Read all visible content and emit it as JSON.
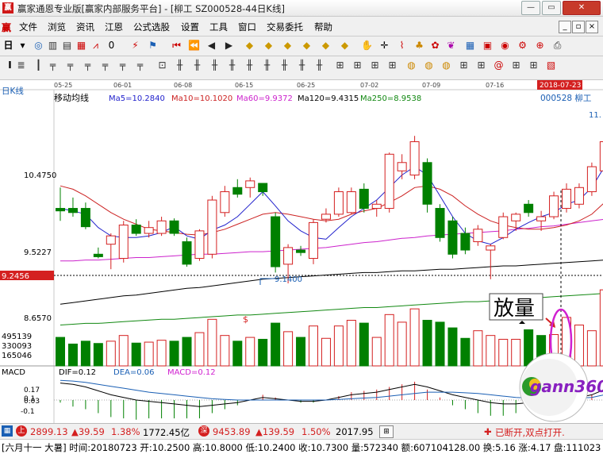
{
  "window": {
    "title": "赢家通恩专业版[赢家内部服务平台] - [柳工  SZ000528-44日K线]",
    "logo": "赢"
  },
  "menu": {
    "logo": "赢",
    "items": [
      "文件",
      "浏览",
      "资讯",
      "江恩",
      "公式选股",
      "设置",
      "工具",
      "窗口",
      "交易委托",
      "帮助"
    ]
  },
  "toolbar1": {
    "period": "日"
  },
  "chart": {
    "period_label": "日K线",
    "indicator_name": "移动均线",
    "ma": [
      {
        "label": "Ma5=10.2840",
        "color": "#2222cc"
      },
      {
        "label": "Ma10=10.1020",
        "color": "#cc2222"
      },
      {
        "label": "Ma60=9.9372",
        "color": "#cc22cc"
      },
      {
        "label": "Ma120=9.4315",
        "color": "#000000"
      },
      {
        "label": "Ma250=8.9538",
        "color": "#118811"
      }
    ],
    "stock_label": "000528  柳工",
    "right_price": "11.",
    "current_date": "2018-07-23",
    "date_ticks": [
      "05-25",
      "06-01",
      "06-08",
      "06-15",
      "06-25",
      "07-02",
      "07-09",
      "07-16"
    ],
    "price_ticks": [
      "10.4750",
      "9.5227",
      "8.6570"
    ],
    "volume_ticks": [
      "495139",
      "330093",
      "165046"
    ],
    "current_price_tag": "9.2456",
    "low_label": "9.1400",
    "dollar_mark": "$",
    "annotation": "放量"
  },
  "chart_data": {
    "type": "candlestick",
    "x_ticks": [
      "05-25",
      "06-01",
      "06-08",
      "06-15",
      "06-25",
      "07-02",
      "07-09",
      "07-16"
    ],
    "y_ticks": [
      10.475,
      9.5227,
      8.657
    ],
    "highlight_date": "2018-07-23",
    "candles": [
      {
        "o": 10.05,
        "h": 10.3,
        "l": 9.9,
        "c": 10.02
      },
      {
        "o": 10.05,
        "h": 10.18,
        "l": 9.95,
        "c": 10.0
      },
      {
        "o": 10.05,
        "h": 10.12,
        "l": 9.8,
        "c": 9.83
      },
      {
        "o": 9.5,
        "h": 9.58,
        "l": 9.45,
        "c": 9.47
      },
      {
        "o": 9.62,
        "h": 9.75,
        "l": 9.32,
        "c": 9.72
      },
      {
        "o": 9.45,
        "h": 9.9,
        "l": 9.4,
        "c": 9.85
      },
      {
        "o": 9.85,
        "h": 9.92,
        "l": 9.72,
        "c": 9.75
      },
      {
        "o": 9.75,
        "h": 9.9,
        "l": 9.7,
        "c": 9.82
      },
      {
        "o": 9.75,
        "h": 9.95,
        "l": 9.72,
        "c": 9.9
      },
      {
        "o": 9.9,
        "h": 9.93,
        "l": 9.72,
        "c": 9.75
      },
      {
        "o": 9.65,
        "h": 9.7,
        "l": 9.35,
        "c": 9.38
      },
      {
        "o": 9.45,
        "h": 9.8,
        "l": 9.42,
        "c": 9.78
      },
      {
        "o": 9.5,
        "h": 10.2,
        "l": 9.45,
        "c": 10.15
      },
      {
        "o": 10.0,
        "h": 10.32,
        "l": 9.95,
        "c": 10.25
      },
      {
        "o": 10.3,
        "h": 10.4,
        "l": 10.18,
        "c": 10.22
      },
      {
        "o": 10.3,
        "h": 10.42,
        "l": 10.18,
        "c": 10.38
      },
      {
        "o": 10.35,
        "h": 10.35,
        "l": 10.2,
        "c": 10.25
      },
      {
        "o": 9.95,
        "h": 10.0,
        "l": 9.28,
        "c": 9.35
      },
      {
        "o": 9.38,
        "h": 9.62,
        "l": 9.15,
        "c": 9.58
      },
      {
        "o": 9.55,
        "h": 9.6,
        "l": 9.48,
        "c": 9.52
      },
      {
        "o": 9.45,
        "h": 9.92,
        "l": 9.38,
        "c": 9.88
      },
      {
        "o": 9.92,
        "h": 10.05,
        "l": 9.88,
        "c": 9.98
      },
      {
        "o": 9.98,
        "h": 10.3,
        "l": 9.95,
        "c": 10.25
      },
      {
        "o": 10.0,
        "h": 10.3,
        "l": 9.98,
        "c": 10.25
      },
      {
        "o": 10.28,
        "h": 10.35,
        "l": 10.0,
        "c": 10.05
      },
      {
        "o": 10.05,
        "h": 10.15,
        "l": 9.95,
        "c": 10.1
      },
      {
        "o": 10.05,
        "h": 10.72,
        "l": 10.0,
        "c": 10.7
      },
      {
        "o": 10.5,
        "h": 10.7,
        "l": 10.4,
        "c": 10.6
      },
      {
        "o": 10.45,
        "h": 10.92,
        "l": 10.4,
        "c": 10.85
      },
      {
        "o": 10.6,
        "h": 10.65,
        "l": 10.0,
        "c": 10.1
      },
      {
        "o": 10.05,
        "h": 10.1,
        "l": 9.65,
        "c": 9.7
      },
      {
        "o": 9.9,
        "h": 9.95,
        "l": 9.45,
        "c": 9.5
      },
      {
        "o": 9.75,
        "h": 9.82,
        "l": 9.5,
        "c": 9.55
      },
      {
        "o": 9.65,
        "h": 9.85,
        "l": 9.6,
        "c": 9.8
      },
      {
        "o": 9.55,
        "h": 9.62,
        "l": 9.2,
        "c": 9.6
      },
      {
        "o": 9.7,
        "h": 10.0,
        "l": 9.68,
        "c": 9.95
      },
      {
        "o": 9.9,
        "h": 10.0,
        "l": 9.78,
        "c": 9.98
      },
      {
        "o": 10.1,
        "h": 10.15,
        "l": 9.95,
        "c": 10.0
      },
      {
        "o": 9.9,
        "h": 10.02,
        "l": 9.78,
        "c": 9.95
      },
      {
        "o": 9.95,
        "h": 10.25,
        "l": 9.92,
        "c": 10.2
      },
      {
        "o": 10.05,
        "h": 10.35,
        "l": 10.0,
        "c": 10.28
      },
      {
        "o": 10.1,
        "h": 10.35,
        "l": 10.05,
        "c": 10.3
      },
      {
        "o": 10.25,
        "h": 10.6,
        "l": 10.2,
        "c": 10.55
      },
      {
        "o": 10.5,
        "h": 11.25,
        "l": 10.45,
        "c": 10.85
      },
      {
        "o": 10.85,
        "h": 11.55,
        "l": 10.8,
        "c": 10.73
      }
    ],
    "volume": [
      {
        "v": 150000,
        "up": false
      },
      {
        "v": 115000,
        "up": false
      },
      {
        "v": 130000,
        "up": false
      },
      {
        "v": 118000,
        "up": false
      },
      {
        "v": 130000,
        "up": true
      },
      {
        "v": 160000,
        "up": true
      },
      {
        "v": 120000,
        "up": false
      },
      {
        "v": 125000,
        "up": true
      },
      {
        "v": 135000,
        "up": true
      },
      {
        "v": 130000,
        "up": false
      },
      {
        "v": 150000,
        "up": false
      },
      {
        "v": 175000,
        "up": true
      },
      {
        "v": 245000,
        "up": true
      },
      {
        "v": 160000,
        "up": true
      },
      {
        "v": 130000,
        "up": false
      },
      {
        "v": 150000,
        "up": true
      },
      {
        "v": 140000,
        "up": false
      },
      {
        "v": 225000,
        "up": false
      },
      {
        "v": 180000,
        "up": true
      },
      {
        "v": 150000,
        "up": false
      },
      {
        "v": 210000,
        "up": true
      },
      {
        "v": 145000,
        "up": true
      },
      {
        "v": 210000,
        "up": true
      },
      {
        "v": 240000,
        "up": true
      },
      {
        "v": 225000,
        "up": false
      },
      {
        "v": 150000,
        "up": true
      },
      {
        "v": 270000,
        "up": true
      },
      {
        "v": 230000,
        "up": true
      },
      {
        "v": 300000,
        "up": true
      },
      {
        "v": 240000,
        "up": false
      },
      {
        "v": 230000,
        "up": false
      },
      {
        "v": 200000,
        "up": false
      },
      {
        "v": 145000,
        "up": false
      },
      {
        "v": 185000,
        "up": true
      },
      {
        "v": 160000,
        "up": true
      },
      {
        "v": 140000,
        "up": true
      },
      {
        "v": 140000,
        "up": true
      },
      {
        "v": 190000,
        "up": false
      },
      {
        "v": 160000,
        "up": false
      },
      {
        "v": 165000,
        "up": true
      },
      {
        "v": 255000,
        "up": true
      },
      {
        "v": 215000,
        "up": true
      },
      {
        "v": 185000,
        "up": true
      },
      {
        "v": 400000,
        "up": true
      },
      {
        "v": 430000,
        "up": true
      }
    ],
    "ma5": [
      10.05,
      10.02,
      9.98,
      9.82,
      9.72,
      9.7,
      9.7,
      9.72,
      9.76,
      9.83,
      9.72,
      9.68,
      9.79,
      9.85,
      9.95,
      10.1,
      10.25,
      10.08,
      9.9,
      9.78,
      9.7,
      9.68,
      9.82,
      9.95,
      10.05,
      10.15,
      10.3,
      10.45,
      10.55,
      10.45,
      10.2,
      9.95,
      9.75,
      9.66,
      9.62,
      9.7,
      9.8,
      9.88,
      9.95,
      10.0,
      10.1,
      10.15,
      10.3,
      10.55,
      10.72
    ],
    "ma10": [
      10.32,
      10.28,
      10.2,
      10.1,
      10.0,
      9.92,
      9.86,
      9.8,
      9.78,
      9.76,
      9.74,
      9.73,
      9.76,
      9.8,
      9.86,
      9.92,
      9.98,
      10.0,
      9.98,
      9.95,
      9.92,
      9.9,
      9.92,
      9.98,
      10.02,
      10.05,
      10.12,
      10.2,
      10.3,
      10.32,
      10.28,
      10.2,
      10.08,
      9.98,
      9.9,
      9.85,
      9.82,
      9.8,
      9.8,
      9.82,
      9.85,
      9.9,
      9.98,
      10.12,
      10.28
    ],
    "ma60": [
      9.42,
      9.42,
      9.43,
      9.43,
      9.44,
      9.45,
      9.46,
      9.46,
      9.47,
      9.48,
      9.49,
      9.5,
      9.5,
      9.51,
      9.52,
      9.53,
      9.53,
      9.54,
      9.55,
      9.56,
      9.57,
      9.58,
      9.6,
      9.62,
      9.64,
      9.65,
      9.67,
      9.69,
      9.7,
      9.72,
      9.73,
      9.74,
      9.75,
      9.76,
      9.77,
      9.78,
      9.8,
      9.81,
      9.83,
      9.84,
      9.86,
      9.88,
      9.9,
      9.92,
      9.94
    ],
    "ma120": [
      8.9,
      8.92,
      8.94,
      8.96,
      8.98,
      9.0,
      9.01,
      9.03,
      9.05,
      9.07,
      9.09,
      9.1,
      9.12,
      9.14,
      9.16,
      9.18,
      9.2,
      9.21,
      9.22,
      9.23,
      9.24,
      9.25,
      9.26,
      9.27,
      9.28,
      9.28,
      9.29,
      9.3,
      9.3,
      9.31,
      9.32,
      9.32,
      9.33,
      9.34,
      9.35,
      9.36,
      9.36,
      9.37,
      9.38,
      9.39,
      9.4,
      9.41,
      9.42,
      9.43,
      9.44
    ],
    "ma250": [
      8.65,
      8.66,
      8.67,
      8.67,
      8.68,
      8.69,
      8.7,
      8.71,
      8.72,
      8.72,
      8.73,
      8.74,
      8.75,
      8.76,
      8.77,
      8.77,
      8.78,
      8.79,
      8.8,
      8.81,
      8.82,
      8.83,
      8.84,
      8.85,
      8.86,
      8.86,
      8.87,
      8.88,
      8.89,
      8.9,
      8.91,
      8.92,
      8.93,
      8.93,
      8.94,
      8.95,
      8.96,
      8.97,
      8.98,
      8.99,
      9.0,
      9.01,
      9.02,
      9.03,
      9.04
    ],
    "macd": {
      "name": "MACD",
      "dif_label": "DIF=0.12",
      "dea_label": "DEA=0.06",
      "macd_label": "MACD=0.12",
      "y_ticks": [
        0.17,
        0.1,
        0.03,
        -0.1
      ],
      "dif": [
        0.13,
        0.12,
        0.1,
        0.07,
        0.04,
        0.02,
        0.0,
        -0.01,
        -0.02,
        -0.03,
        -0.04,
        -0.05,
        -0.04,
        -0.03,
        -0.02,
        0.0,
        0.02,
        0.01,
        0.0,
        -0.01,
        -0.01,
        0.0,
        0.02,
        0.04,
        0.05,
        0.06,
        0.08,
        0.1,
        0.12,
        0.1,
        0.07,
        0.04,
        0.02,
        0.0,
        -0.02,
        -0.03,
        -0.03,
        -0.02,
        -0.02,
        -0.01,
        0.0,
        0.02,
        0.04,
        0.08,
        0.12
      ],
      "dea": [
        0.15,
        0.145,
        0.135,
        0.12,
        0.105,
        0.09,
        0.075,
        0.06,
        0.05,
        0.04,
        0.03,
        0.02,
        0.01,
        0.005,
        0.0,
        0.0,
        0.0,
        0.0,
        0.0,
        0.0,
        0.0,
        0.0,
        0.005,
        0.01,
        0.015,
        0.02,
        0.03,
        0.04,
        0.05,
        0.06,
        0.06,
        0.06,
        0.055,
        0.05,
        0.04,
        0.03,
        0.02,
        0.015,
        0.01,
        0.01,
        0.01,
        0.015,
        0.02,
        0.04,
        0.06
      ],
      "hist": [
        -0.02,
        -0.05,
        -0.07,
        -0.1,
        -0.13,
        -0.14,
        -0.15,
        -0.14,
        -0.14,
        -0.14,
        -0.14,
        -0.14,
        -0.1,
        -0.07,
        -0.04,
        0.0,
        0.04,
        0.02,
        0.0,
        -0.02,
        -0.02,
        0.0,
        0.03,
        0.06,
        0.07,
        0.08,
        0.1,
        0.12,
        0.14,
        0.08,
        0.02,
        -0.04,
        -0.07,
        -0.1,
        -0.12,
        -0.12,
        -0.1,
        -0.07,
        -0.06,
        -0.04,
        -0.02,
        0.01,
        0.04,
        0.08,
        0.12
      ]
    }
  },
  "watermark": {
    "text": "gann360"
  },
  "statusbar": {
    "idx1_value": "2899.13",
    "idx1_change": "▲39.59",
    "idx1_pct": "1.38%",
    "idx1_amount": "1772.45亿",
    "idx2_value": "9453.89",
    "idx2_change": "▲139.59",
    "idx2_pct": "1.50%",
    "idx2_amount": "2017.95",
    "connection": "已断开,双点打开."
  },
  "infobar": {
    "text": "[六月十一 大暑] 时间:20180723 开:10.2500 高:10.8000 低:10.2400 收:10.7300 量:572340 额:607104128.00 换:5.16 涨:4.17 盘:111023"
  },
  "colors": {
    "up": "#d42020",
    "down": "#008000",
    "bg": "#ffffff"
  }
}
